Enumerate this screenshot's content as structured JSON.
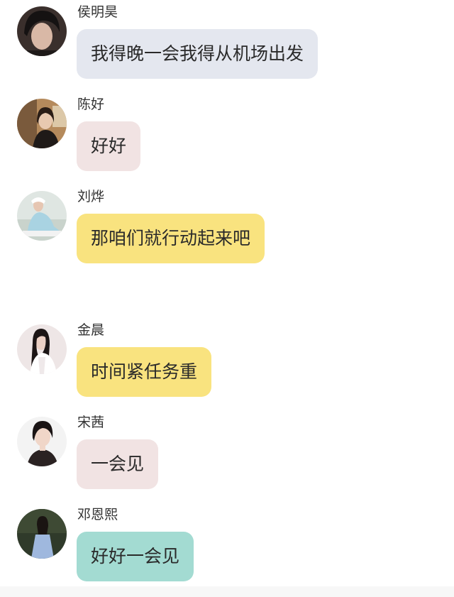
{
  "colors": {
    "bubble_gray": "#e4e7ef",
    "bubble_pink": "#f1e3e3",
    "bubble_yellow": "#f9e37f",
    "bubble_teal": "#a3dbd2"
  },
  "messages": [
    {
      "sender": "侯明昊",
      "text": "我得晚一会我得从机场出发"
    },
    {
      "sender": "陈好",
      "text": "好好"
    },
    {
      "sender": "刘烨",
      "text": "那咱们就行动起来吧"
    },
    {
      "sender": "金晨",
      "text": "时间紧任务重"
    },
    {
      "sender": "宋茜",
      "text": "一会见"
    },
    {
      "sender": "邓恩熙",
      "text": "好好一会见"
    }
  ]
}
